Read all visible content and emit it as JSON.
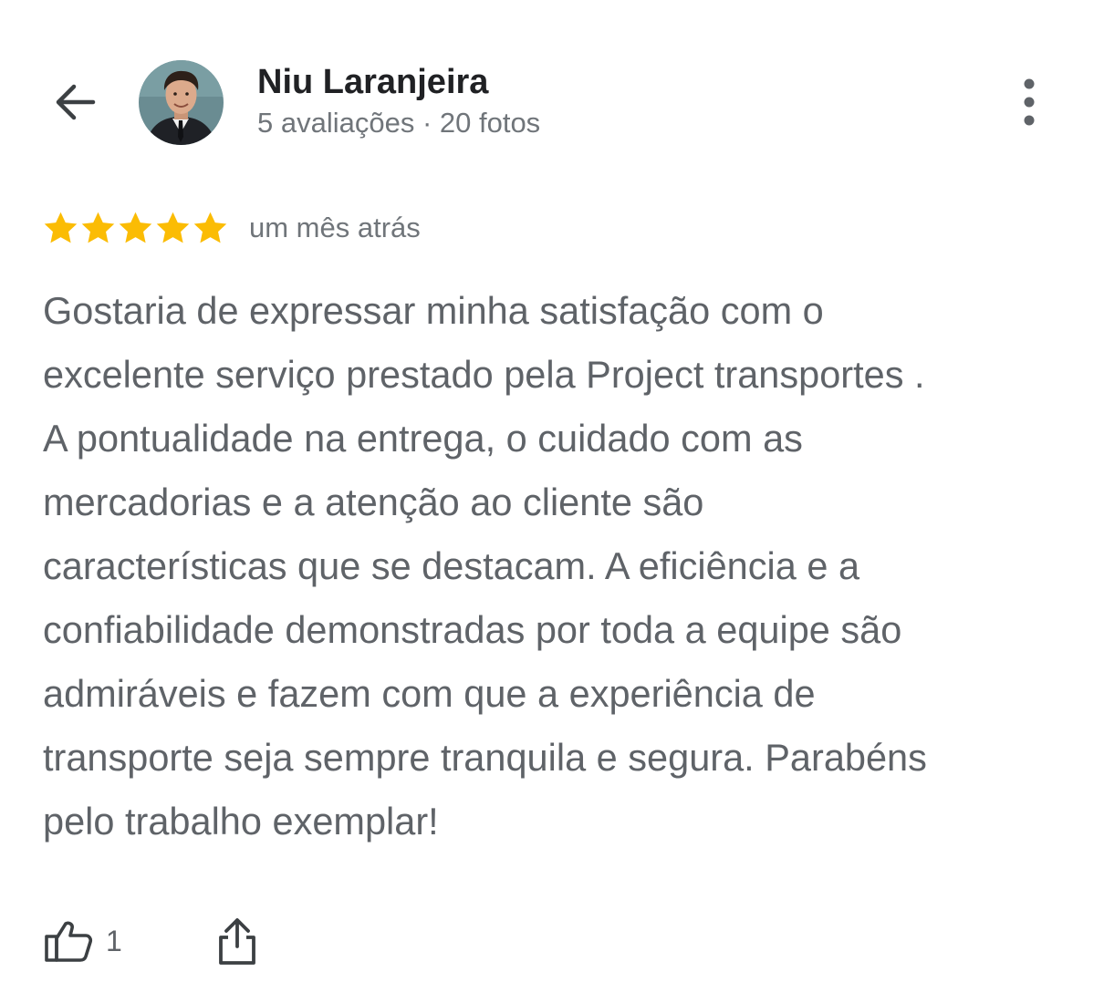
{
  "header": {
    "back_icon": "arrow-left-icon",
    "reviewer_name": "Niu Laranjeira",
    "reviewer_meta": "5 avaliações · 20 fotos",
    "more_icon": "more-vert-icon"
  },
  "review": {
    "rating": 5,
    "rating_max": 5,
    "star_color": "#fbbc04",
    "date": "um mês atrás",
    "lines": [
      "Gostaria de expressar minha satisfação com o",
      "excelente serviço prestado pela Project transportes .",
      "A pontualidade na entrega, o cuidado com as",
      "mercadorias e a atenção ao cliente são",
      "características que se destacam. A eficiência e a",
      "confiabilidade demonstradas por toda a equipe são",
      "admiráveis e fazem com que a experiência de",
      "transporte seja sempre tranquila e segura. Parabéns",
      "pelo trabalho exemplar!"
    ]
  },
  "actions": {
    "like_icon": "thumbs-up-icon",
    "like_count": "1",
    "share_icon": "share-icon"
  }
}
